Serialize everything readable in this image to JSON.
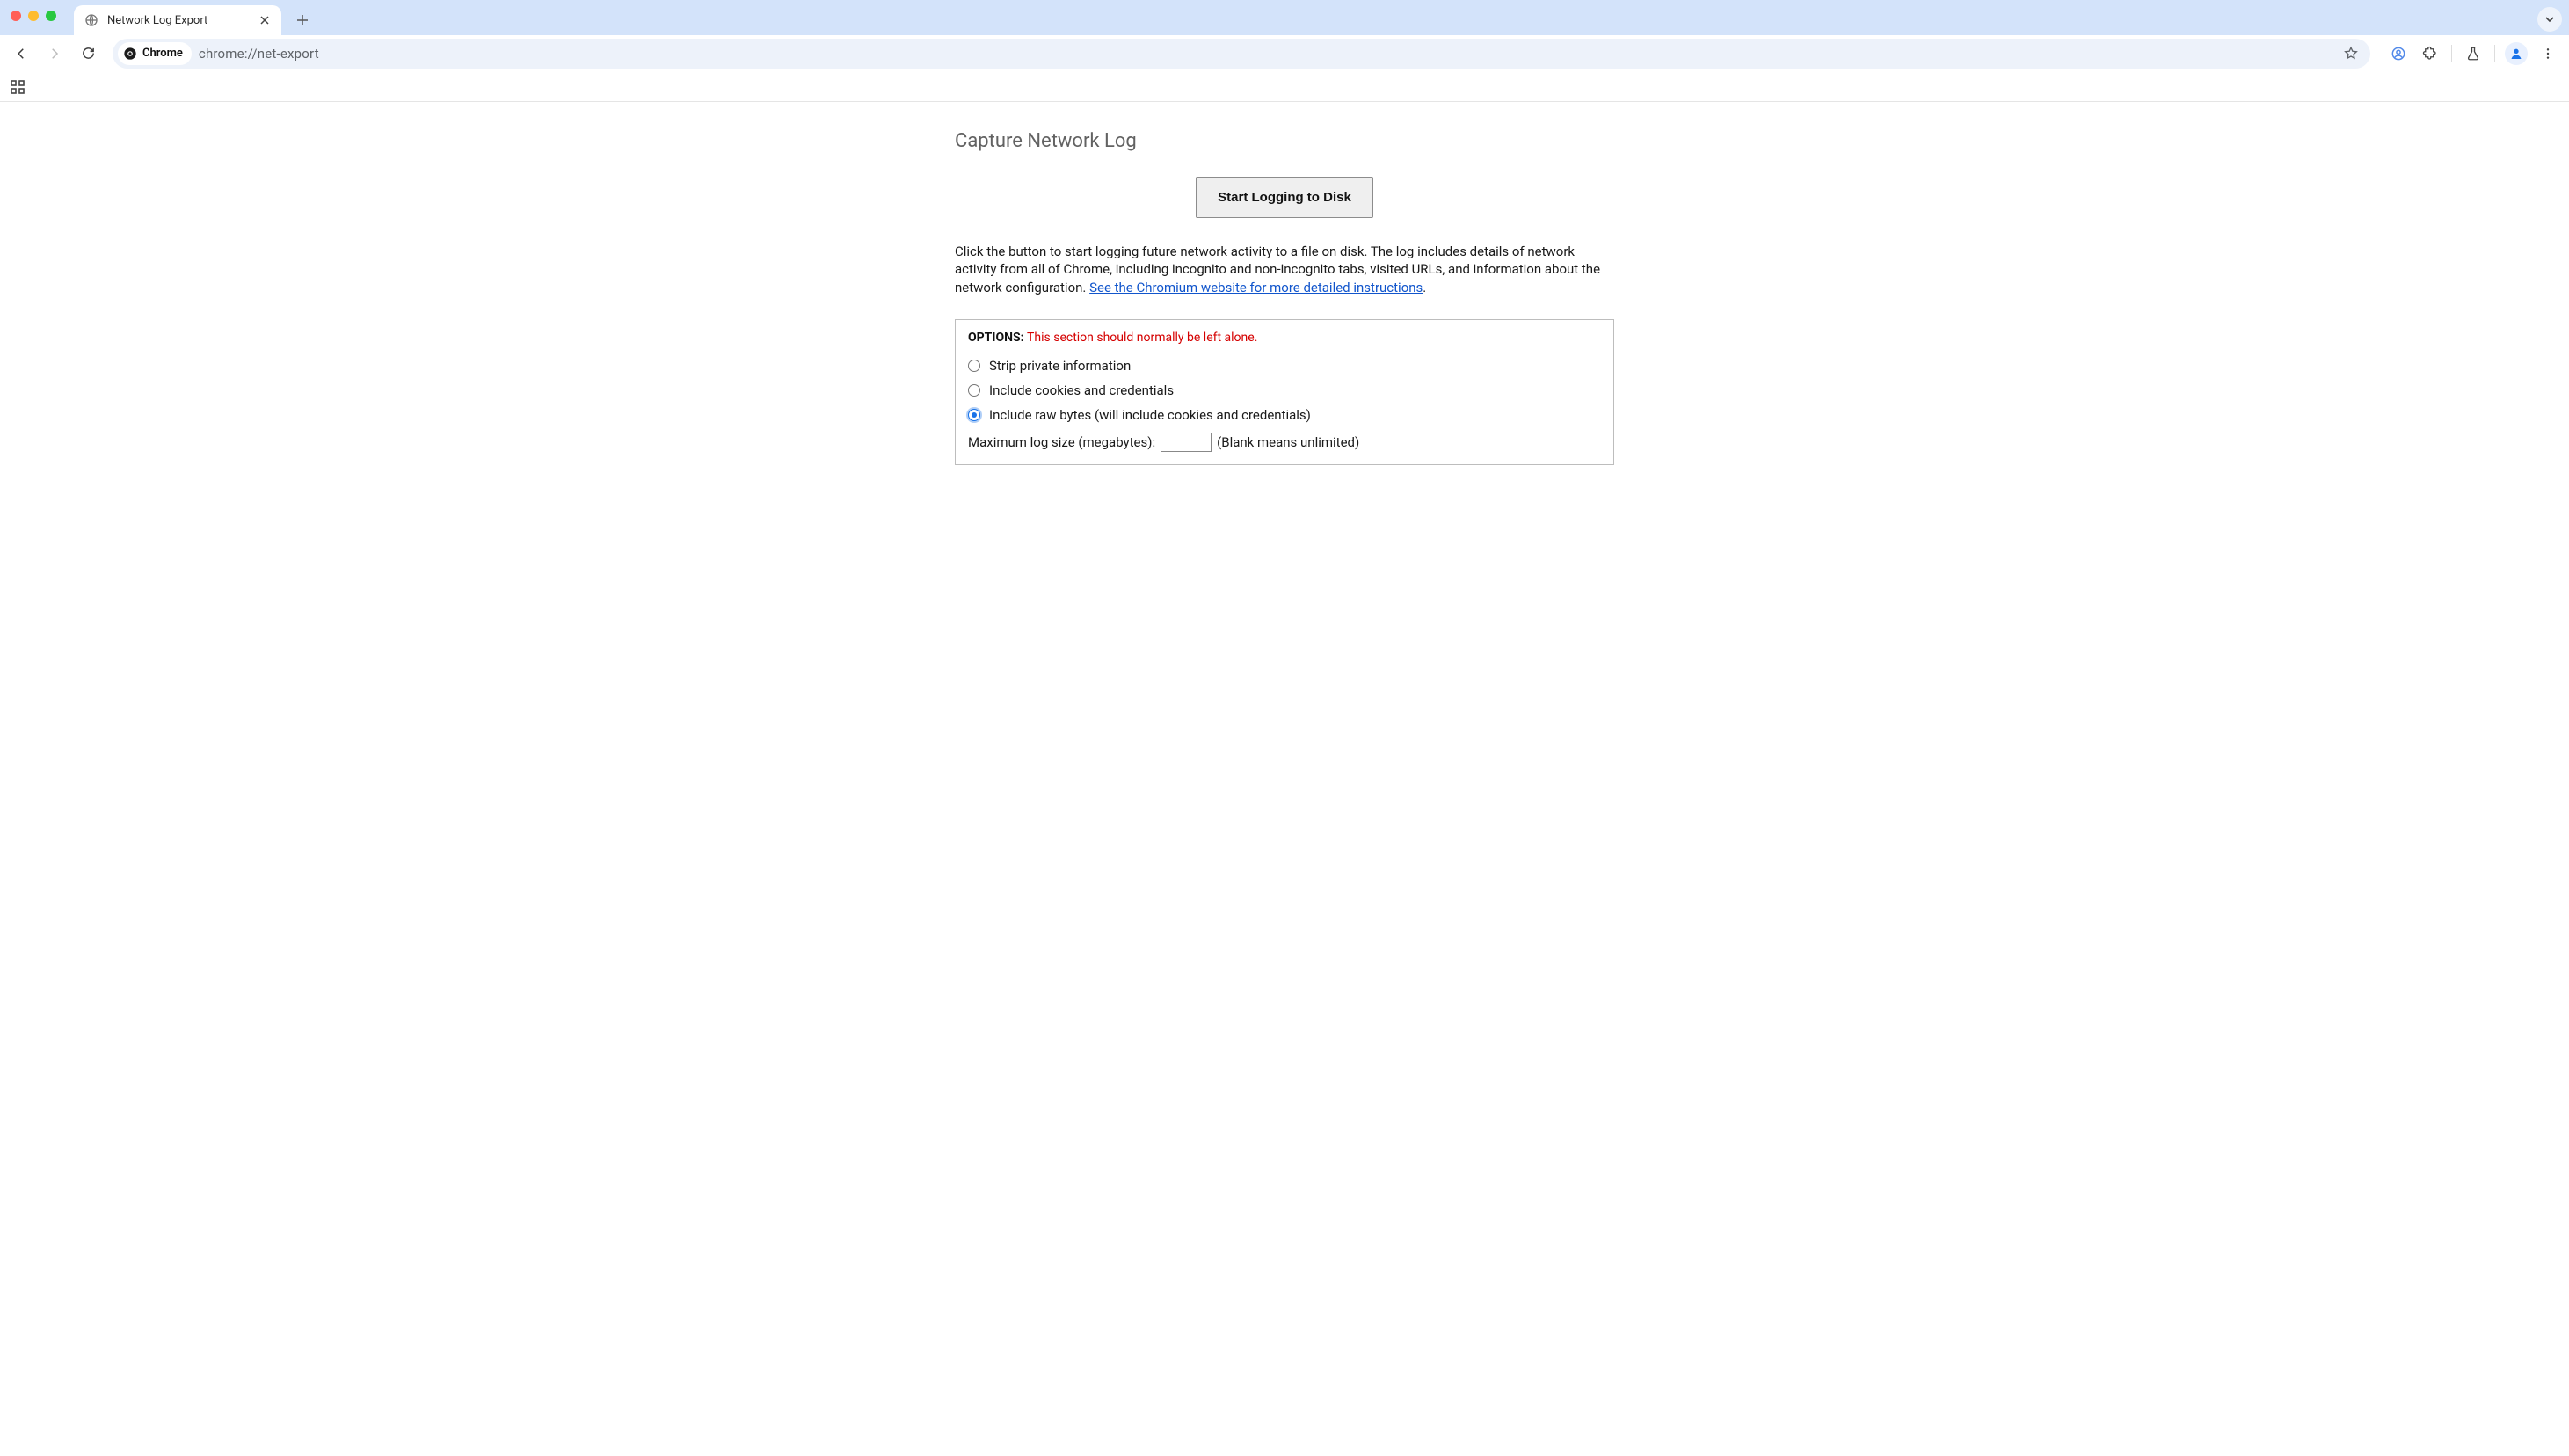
{
  "tab": {
    "title": "Network Log Export"
  },
  "omnibox": {
    "chip_label": "Chrome",
    "url": "chrome://net-export"
  },
  "page": {
    "title": "Capture Network Log",
    "start_button": "Start Logging to Disk",
    "description_pre": "Click the button to start logging future network activity to a file on disk. The log includes details of network activity from all of Chrome, including incognito and non-incognito tabs, visited URLs, and information about the network configuration. ",
    "description_link": "See the Chromium website for more detailed instructions",
    "description_post": "."
  },
  "options": {
    "label": "OPTIONS",
    "label_suffix": ": ",
    "warning": "This section should normally be left alone.",
    "radio1": "Strip private information",
    "radio2": "Include cookies and credentials",
    "radio3": "Include raw bytes (will include cookies and credentials)",
    "selected_index": 2,
    "max_size_label": "Maximum log size (megabytes): ",
    "max_size_value": "",
    "max_size_hint": "(Blank means unlimited)"
  }
}
